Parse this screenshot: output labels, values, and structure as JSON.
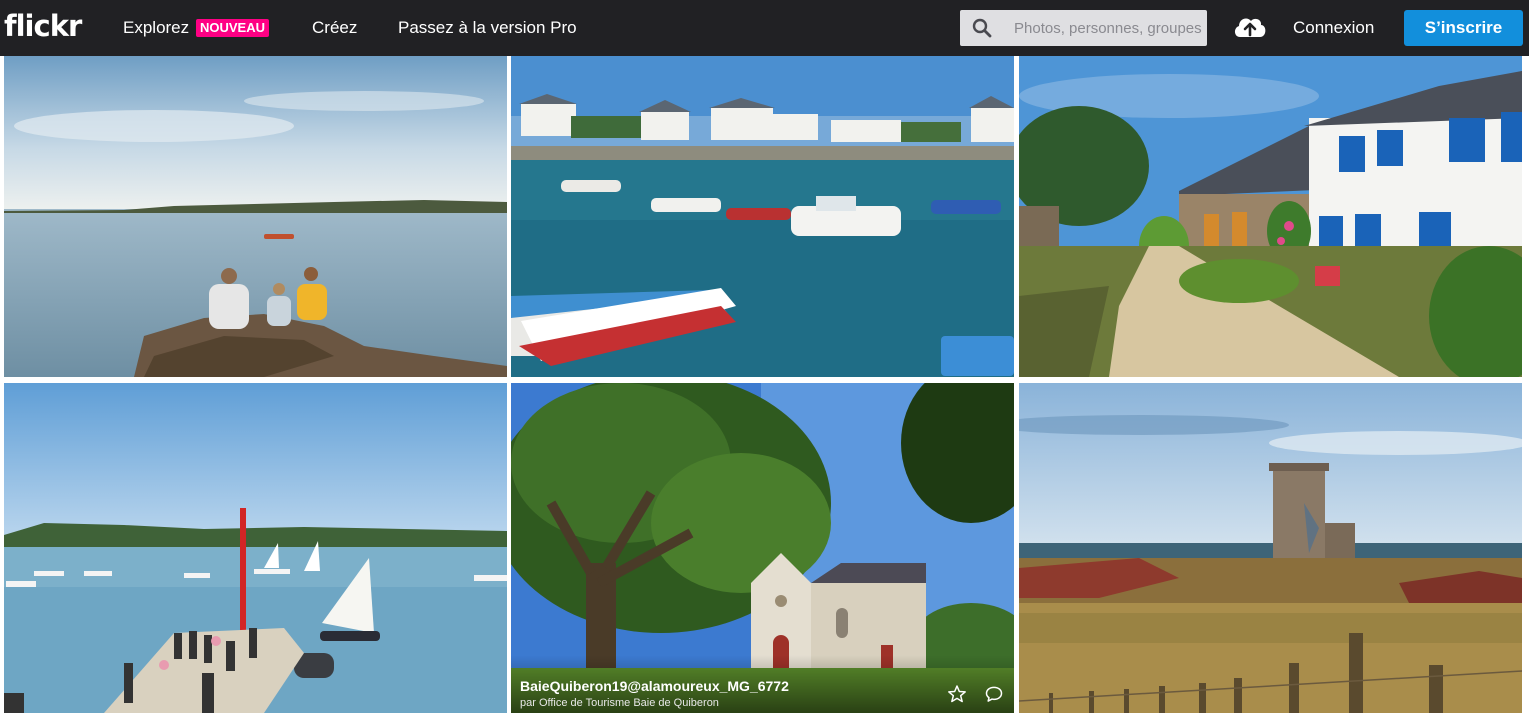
{
  "brand": {
    "logo_text": "flickr"
  },
  "nav": {
    "explore_label": "Explorez",
    "explore_badge": "NOUVEAU",
    "create_label": "Créez",
    "pro_label": "Passez à la version Pro"
  },
  "search": {
    "placeholder": "Photos, personnes, groupes",
    "icon": "search-icon"
  },
  "actions": {
    "upload_icon": "cloud-upload-icon",
    "login_label": "Connexion",
    "signup_label": "S’inscrire"
  },
  "colors": {
    "topbar": "#212124",
    "badge": "#ff0084",
    "signup": "#128fdc"
  },
  "photos": [
    {
      "subject": "coastal-bay-people-on-rocks"
    },
    {
      "subject": "harbour-boats"
    },
    {
      "subject": "village-path-blue-shutters"
    },
    {
      "subject": "pier-sailboats"
    },
    {
      "subject": "chapel-under-oak",
      "title": "BaieQuiberon19@alamoureux_MG_6772",
      "author": "par Office de Tourisme Baie de Quiberon",
      "actions": {
        "favorite_icon": "star-icon",
        "comment_icon": "comment-icon"
      }
    },
    {
      "subject": "old-watchtower-heath"
    }
  ]
}
